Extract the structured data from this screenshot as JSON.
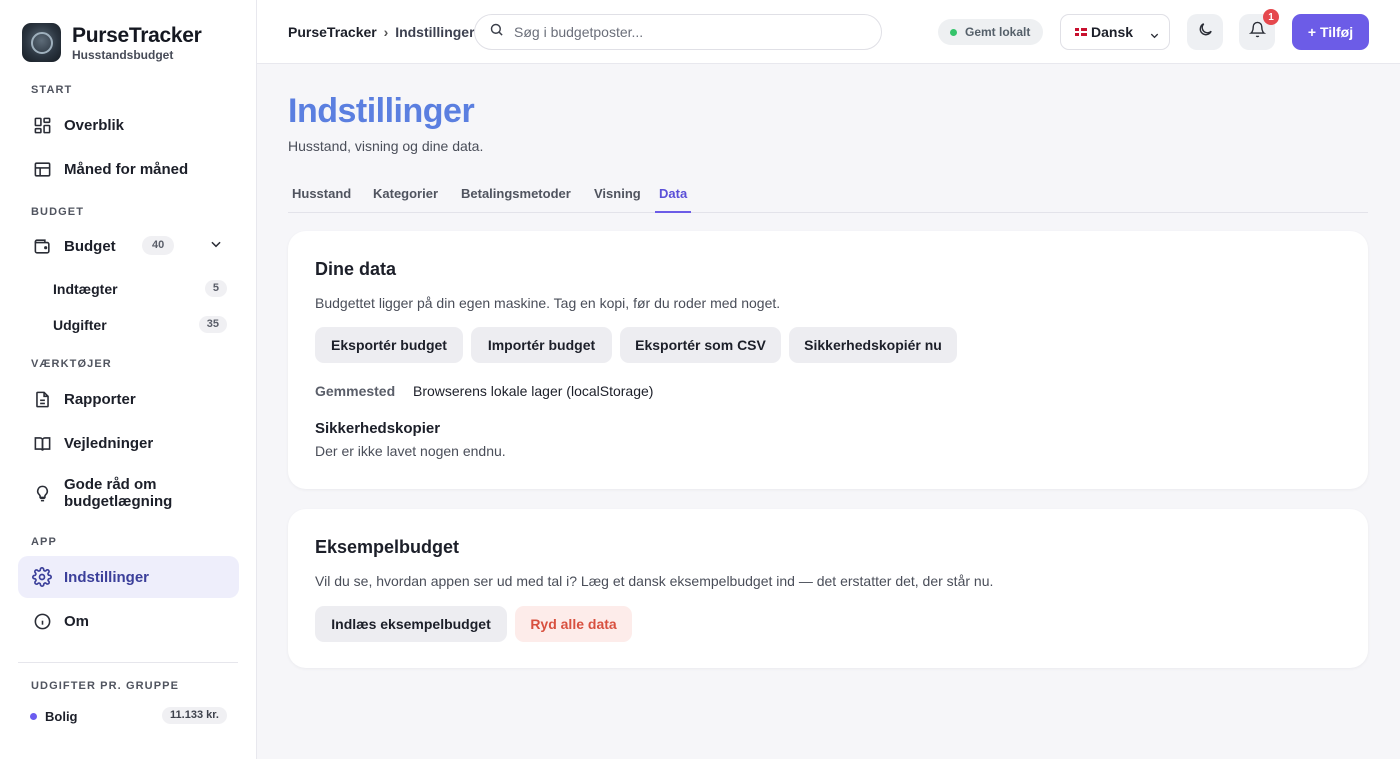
{
  "brand": {
    "name": "PurseTracker",
    "subtitle": "Husstandsbudget"
  },
  "sidebar": {
    "sections": {
      "start": "START",
      "budget": "BUDGET",
      "tools": "VÆRKTØJER",
      "app": "APP",
      "groups": "UDGIFTER PR. GRUPPE"
    },
    "items": {
      "overview": "Overblik",
      "monthly": "Måned for måned",
      "budget": "Budget",
      "budget_count": "40",
      "income": "Indtægter",
      "income_count": "5",
      "expenses": "Udgifter",
      "expenses_count": "35",
      "reports": "Rapporter",
      "guides": "Vejledninger",
      "advice": "Gode råd om budgetlægning",
      "settings": "Indstillinger",
      "about": "Om"
    },
    "groups": [
      {
        "name": "Bolig",
        "value": "11.133 kr.",
        "color": "#6b5cf0"
      }
    ]
  },
  "topbar": {
    "breadcrumb_root": "PurseTracker",
    "breadcrumb_sep": "›",
    "breadcrumb_current": "Indstillinger",
    "search_placeholder": "Søg i budgetposter...",
    "saved_status": "Gemt lokalt",
    "language": "Dansk",
    "notification_count": "1",
    "add_label": "+ Tilføj"
  },
  "page": {
    "title": "Indstillinger",
    "subtitle": "Husstand, visning og dine data.",
    "tabs": [
      "Husstand",
      "Kategorier",
      "Betalingsmetoder",
      "Visning",
      "Data"
    ],
    "active_tab": "Data"
  },
  "data_card": {
    "title": "Dine data",
    "description": "Budgettet ligger på din egen maskine. Tag en kopi, før du roder med noget.",
    "buttons": {
      "export": "Eksportér budget",
      "import": "Importér budget",
      "export_csv": "Eksportér som CSV",
      "backup_now": "Sikkerhedskopiér nu"
    },
    "storage_label": "Gemmested",
    "storage_value": "Browserens lokale lager (localStorage)",
    "backups_title": "Sikkerhedskopier",
    "backups_empty": "Der er ikke lavet nogen endnu."
  },
  "example_card": {
    "title": "Eksempelbudget",
    "description": "Vil du se, hvordan appen ser ud med tal i? Læg et dansk eksempelbudget ind — det erstatter det, der står nu.",
    "load_label": "Indlæs eksempelbudget",
    "clear_label": "Ryd alle data"
  },
  "colors": {
    "accent": "#6c5ce7",
    "title": "#5b7fe0",
    "danger": "#d8503f",
    "saved_dot": "#35c46b"
  }
}
